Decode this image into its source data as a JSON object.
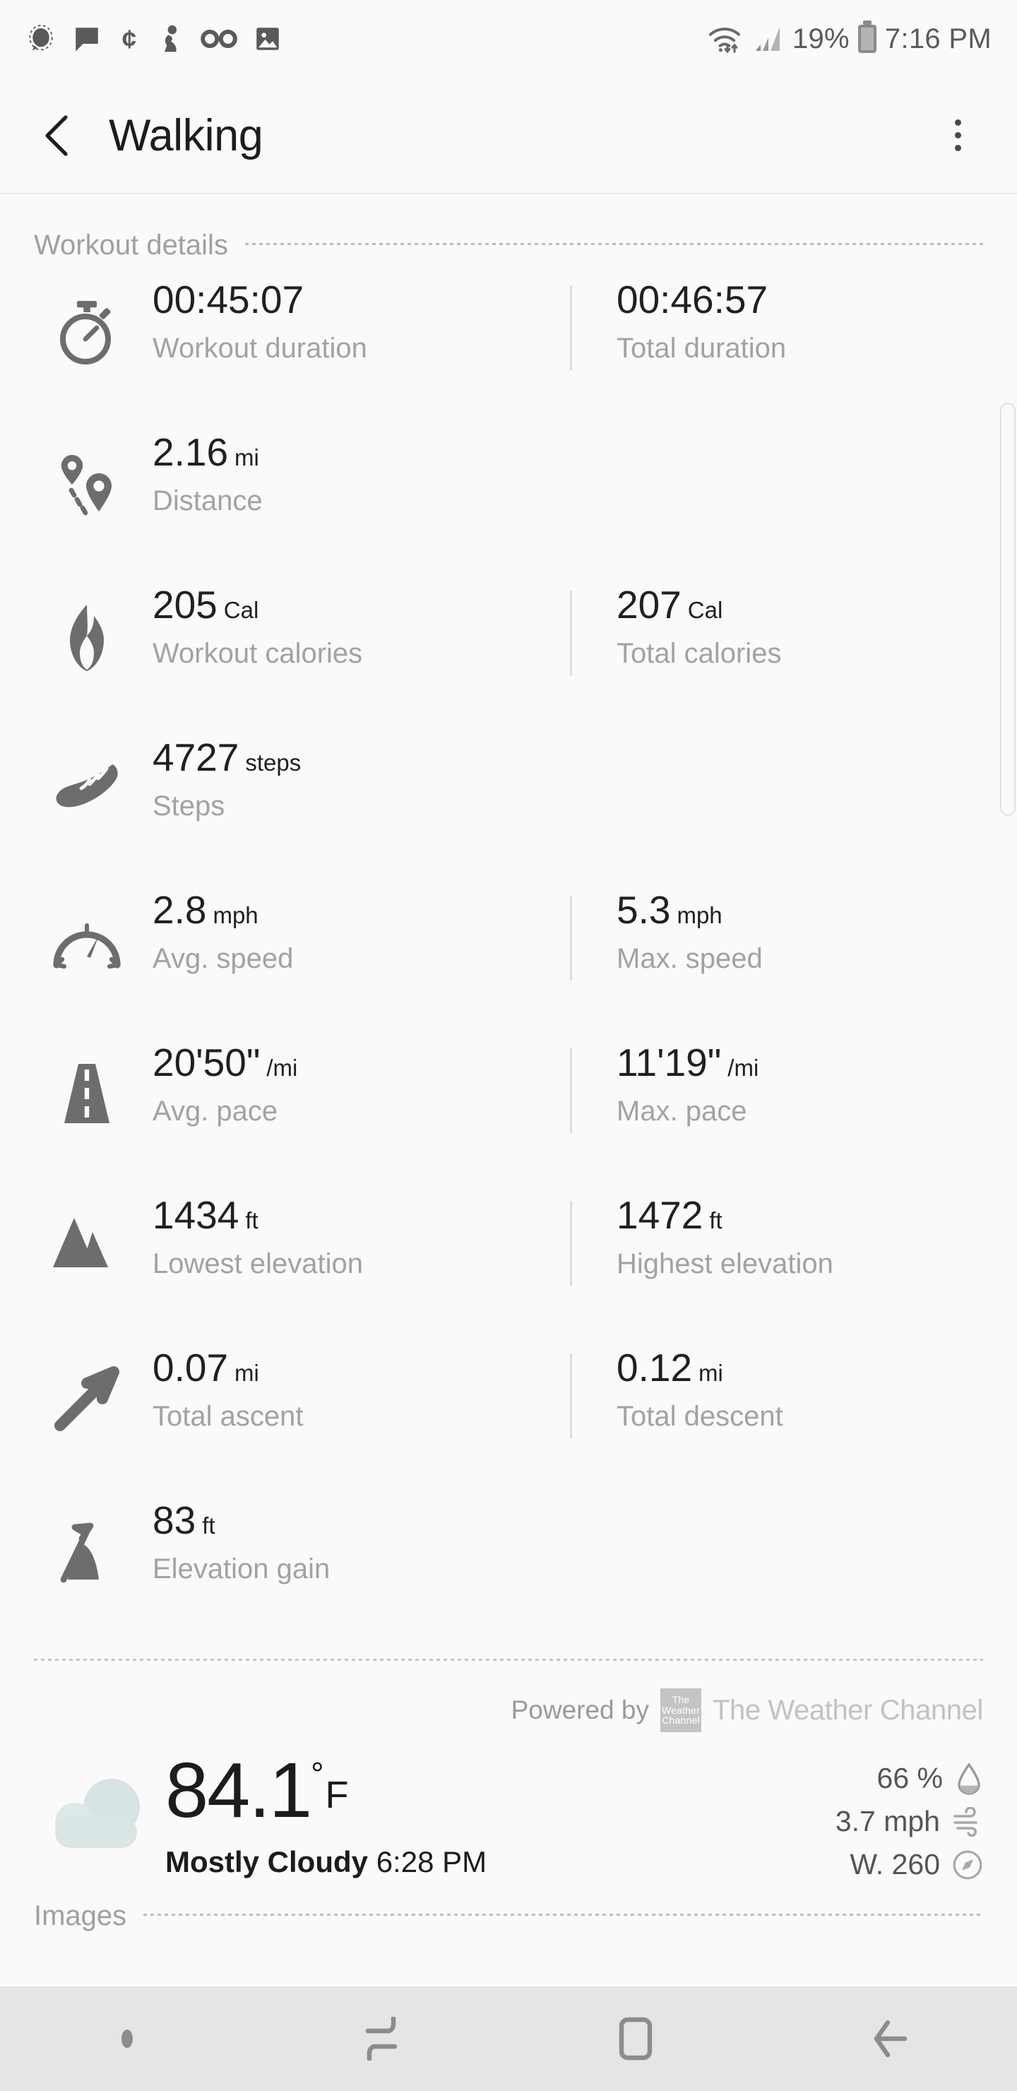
{
  "statusbar": {
    "icons_left": [
      "signal-bubble-icon",
      "message-icon",
      "cent-icon",
      "person-icon",
      "voicemail-icon",
      "image-icon"
    ],
    "wifi_icon": "wifi-updown-icon",
    "cellular_icon": "cellular-signal-icon",
    "battery_percent": "19%",
    "battery_icon": "battery-icon",
    "time": "7:16 PM"
  },
  "appbar": {
    "back_icon": "back-chevron-icon",
    "title": "Walking",
    "menu_icon": "overflow-menu-icon"
  },
  "sections": {
    "workout_details_label": "Workout details",
    "images_label": "Images"
  },
  "metrics": [
    {
      "icon": "stopwatch-icon",
      "left": {
        "value": "00:45:07",
        "unit": "",
        "caption": "Workout duration"
      },
      "right": {
        "value": "00:46:57",
        "unit": "",
        "caption": "Total duration"
      }
    },
    {
      "icon": "route-pins-icon",
      "left": {
        "value": "2.16",
        "unit": "mi",
        "caption": "Distance"
      },
      "right": null
    },
    {
      "icon": "flame-icon",
      "left": {
        "value": "205",
        "unit": "Cal",
        "caption": "Workout calories"
      },
      "right": {
        "value": "207",
        "unit": "Cal",
        "caption": "Total calories"
      }
    },
    {
      "icon": "shoe-icon",
      "left": {
        "value": "4727",
        "unit": "steps",
        "caption": "Steps"
      },
      "right": null
    },
    {
      "icon": "speedometer-icon",
      "left": {
        "value": "2.8",
        "unit": "mph",
        "caption": "Avg. speed"
      },
      "right": {
        "value": "5.3",
        "unit": "mph",
        "caption": "Max. speed"
      }
    },
    {
      "icon": "road-icon",
      "left": {
        "value": "20'50\"",
        "unit": "/mi",
        "caption": "Avg. pace"
      },
      "right": {
        "value": "11'19\"",
        "unit": "/mi",
        "caption": "Max. pace"
      }
    },
    {
      "icon": "mountain-icon",
      "left": {
        "value": "1434",
        "unit": "ft",
        "caption": "Lowest elevation"
      },
      "right": {
        "value": "1472",
        "unit": "ft",
        "caption": "Highest elevation"
      }
    },
    {
      "icon": "arrow-up-right-icon",
      "left": {
        "value": "0.07",
        "unit": "mi",
        "caption": "Total ascent"
      },
      "right": {
        "value": "0.12",
        "unit": "mi",
        "caption": "Total descent"
      }
    },
    {
      "icon": "elevation-gain-icon",
      "left": {
        "value": "83",
        "unit": "ft",
        "caption": "Elevation gain"
      },
      "right": null
    }
  ],
  "weather": {
    "powered_by": "Powered by",
    "provider_mark_lines": [
      "The",
      "Weather",
      "Channel"
    ],
    "provider_name": "The Weather Channel",
    "condition_icon": "cloudy-icon",
    "temperature": "84.1",
    "degree_symbol": "°",
    "temp_unit": "F",
    "condition": "Mostly Cloudy",
    "observed_time": "6:28 PM",
    "side_metrics": [
      {
        "text": "66 %",
        "icon": "humidity-droplet-icon"
      },
      {
        "text": "3.7 mph",
        "icon": "wind-icon"
      },
      {
        "text": "W. 260",
        "icon": "compass-icon"
      }
    ],
    "cloud_color": "#d6e4e3"
  },
  "navbar": {
    "buttons": [
      "nav-dot",
      "recents-icon",
      "home-icon",
      "back-icon"
    ]
  }
}
